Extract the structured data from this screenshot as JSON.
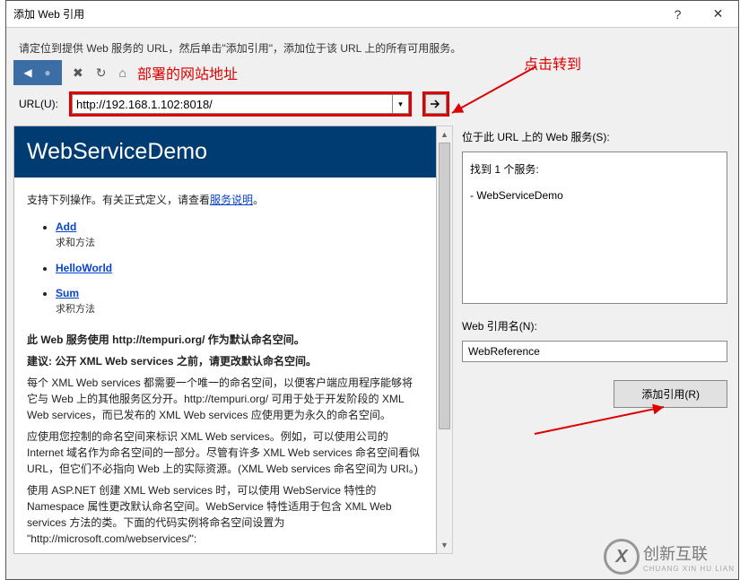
{
  "window": {
    "title": "添加 Web 引用",
    "help": "?",
    "close": "✕"
  },
  "instructions": "请定位到提供 Web 服务的 URL，然后单击\"添加引用\"，添加位于该 URL 上的所有可用服务。",
  "annotations": {
    "deploy_label": "部署的网站地址",
    "click_go": "点击转到"
  },
  "toolbar": {
    "back": "◀",
    "fwd_disabled": "●",
    "stop": "✖",
    "refresh": "↻",
    "home": "⌂"
  },
  "url": {
    "label": "URL(U):",
    "value": "http://192.168.1.102:8018/",
    "dropdown": "▾",
    "go": "➜"
  },
  "content": {
    "heading": "WebServiceDemo",
    "intro_prefix": "支持下列操作。有关正式定义，请查看",
    "intro_link": "服务说明",
    "intro_suffix": "。",
    "ops": [
      {
        "name": "Add",
        "desc": "求和方法"
      },
      {
        "name": "HelloWorld",
        "desc": ""
      },
      {
        "name": "Sum",
        "desc": "求积方法"
      }
    ],
    "ns_line": "此 Web 服务使用 http://tempuri.org/ 作为默认命名空间。",
    "advice_line": "建议: 公开 XML Web services 之前，请更改默认命名空间。",
    "para1": "每个 XML Web services 都需要一个唯一的命名空间，以便客户端应用程序能够将它与 Web 上的其他服务区分开。http://tempuri.org/ 可用于处于开发阶段的 XML Web services，而已发布的 XML Web services 应使用更为永久的命名空间。",
    "para2": "应使用您控制的命名空间来标识 XML Web services。例如，可以使用公司的 Internet 域名作为命名空间的一部分。尽管有许多 XML Web services 命名空间看似 URL，但它们不必指向 Web 上的实际资源。(XML Web services 命名空间为 URI。)",
    "para3": "使用 ASP.NET 创建 XML Web services 时，可以使用 WebService 特性的 Namespace 属性更改默认命名空间。WebService 特性适用于包含 XML Web services 方法的类。下面的代码实例将命名空间设置为 \"http://microsoft.com/webservices/\":"
  },
  "right": {
    "services_label": "位于此 URL 上的 Web 服务(S):",
    "found": "找到 1 个服务:",
    "service_name": "- WebServiceDemo",
    "refname_label": "Web 引用名(N):",
    "refname_value": "WebReference",
    "add_button": "添加引用(R)"
  },
  "watermark": {
    "logo": "X",
    "text": "创新互联",
    "sub": "CHUANG XIN HU LIAN"
  }
}
